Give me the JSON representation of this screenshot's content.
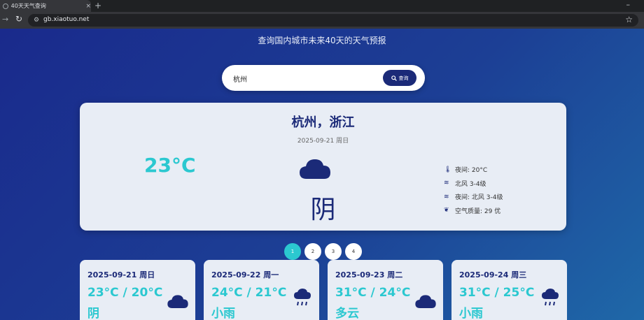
{
  "browser": {
    "tab_title": "40天天气查询",
    "new_tab": "+",
    "tab_close": "×",
    "minimize": "–",
    "url": "gb.xiaotuo.net"
  },
  "page": {
    "subtitle": "查询国内城市未来40天的天气预报"
  },
  "search": {
    "value": "杭州",
    "button_label": "查询"
  },
  "current": {
    "city": "杭州，浙江",
    "date": "2025-09-21 周日",
    "temperature": "23°C",
    "condition": "阴",
    "icon": "cloud-icon",
    "details": [
      {
        "icon": "thermometer-icon",
        "text": "夜间: 20°C"
      },
      {
        "icon": "wind-icon",
        "text": "北风 3-4级"
      },
      {
        "icon": "wind-icon",
        "text": "夜间: 北风 3-4级"
      },
      {
        "icon": "leaf-icon",
        "text": "空气质量: 29 优"
      }
    ]
  },
  "pagination": {
    "pages": [
      "1",
      "2",
      "3",
      "4"
    ],
    "active": "1"
  },
  "forecast": [
    {
      "date": "2025-09-21 周日",
      "temp": "23°C / 20°C",
      "cond": "阴",
      "icon": "cloud-icon"
    },
    {
      "date": "2025-09-22 周一",
      "temp": "24°C / 21°C",
      "cond": "小雨",
      "icon": "rain-icon"
    },
    {
      "date": "2025-09-23 周二",
      "temp": "31°C / 24°C",
      "cond": "多云",
      "icon": "cloud-icon"
    },
    {
      "date": "2025-09-24 周三",
      "temp": "31°C / 25°C",
      "cond": "小雨",
      "icon": "rain-icon"
    }
  ],
  "colors": {
    "accent": "#2bc8d0",
    "primary": "#1b2a78",
    "card": "#e8edf5"
  }
}
